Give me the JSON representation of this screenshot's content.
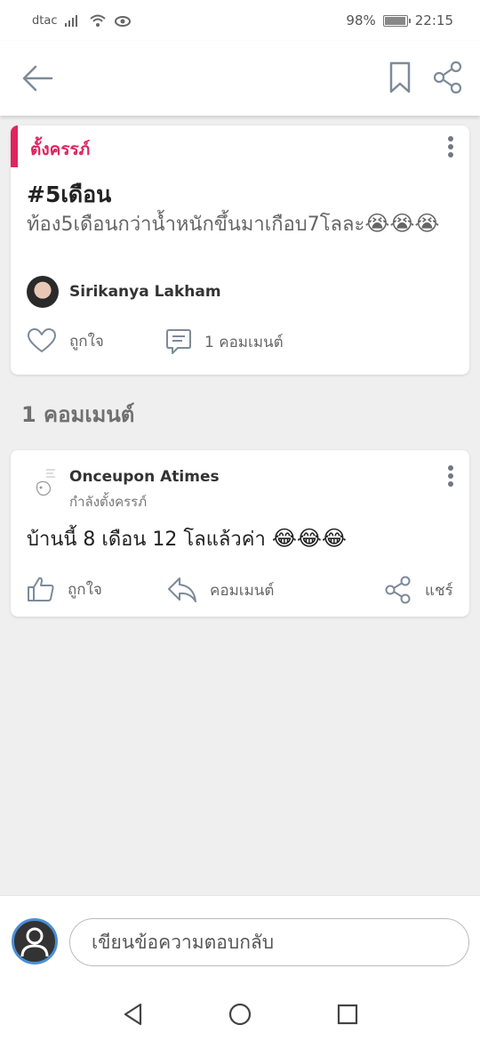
{
  "status_bar": {
    "carrier": "dtac",
    "battery_percent": "98%",
    "battery_level": 0.98,
    "time": "22:15"
  },
  "app_bar": {
    "icons": [
      "back-arrow-icon",
      "bookmark-icon",
      "share-icon"
    ]
  },
  "post": {
    "category": "ตั้งครรภ์",
    "title": "#5เดือน",
    "body": "ท้อง5เดือนกว่าน้ำหนักขึ้นมาเกือบ7โลละ",
    "body_emojis": "😭😭😭",
    "author": "Sirikanya Lakham",
    "like_label": "ถูกใจ",
    "comment_label": "1 คอมเมนต์"
  },
  "comments_section": {
    "heading": "1 คอมเมนต์",
    "items": [
      {
        "name": "Onceupon Atimes",
        "status": "กำลังตั้งครรภ์",
        "text": "บ้านนี้ 8 เดือน 12 โลแล้วค่า",
        "emojis": "😂😂😂",
        "like_label": "ถูกใจ",
        "reply_label": "คอมเมนต์",
        "share_label": "แชร์"
      }
    ]
  },
  "reply_bar": {
    "placeholder": "เขียนข้อความตอบกลับ"
  },
  "colors": {
    "accent": "#e0245e",
    "background": "#efefef",
    "icon_gray": "#707884"
  }
}
